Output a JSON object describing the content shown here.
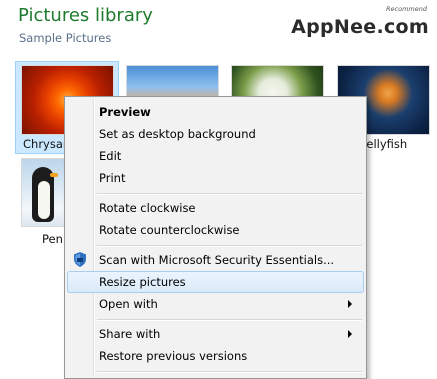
{
  "header": {
    "title": "Pictures library",
    "subtitle": "Sample Pictures"
  },
  "watermark": {
    "logo_text": "AppNee.com",
    "tag_text": "Recommend"
  },
  "thumbnails": [
    {
      "name": "Chrysanthemum",
      "caption_visible": "Chrysan",
      "selected": true
    },
    {
      "name": "Desert",
      "caption_visible": ""
    },
    {
      "name": "Hydrangeas",
      "caption_visible": ""
    },
    {
      "name": "Jellyfish",
      "caption_visible": "Jellyfish"
    },
    {
      "name": "Penguins",
      "caption_visible": "Pen"
    }
  ],
  "context_menu": {
    "items": [
      {
        "label": "Preview",
        "bold": true
      },
      {
        "label": "Set as desktop background"
      },
      {
        "label": "Edit"
      },
      {
        "label": "Print"
      },
      {
        "label": "Rotate clockwise"
      },
      {
        "label": "Rotate counterclockwise"
      },
      {
        "label": "Scan with Microsoft Security Essentials...",
        "icon": "security-shield-icon"
      },
      {
        "label": "Resize pictures",
        "highlighted": true
      },
      {
        "label": "Open with",
        "submenu": true
      },
      {
        "label": "Share with",
        "submenu": true
      },
      {
        "label": "Restore previous versions"
      }
    ]
  },
  "colors": {
    "title_green": "#1e7b2e",
    "selection_blue": "#cce8ff",
    "menu_bg": "#f2f2f2"
  }
}
